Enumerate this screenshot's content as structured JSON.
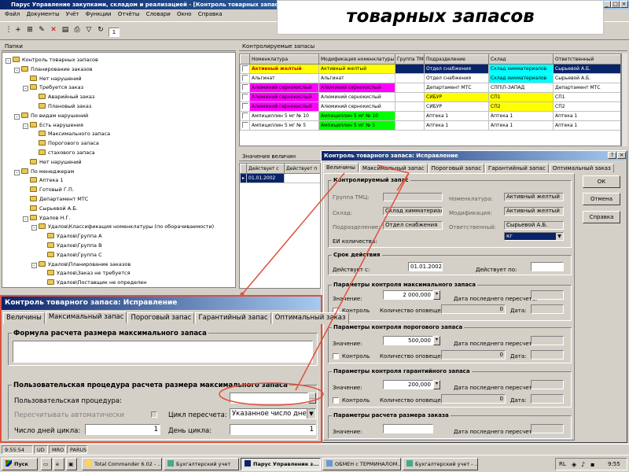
{
  "overlay_title": "товарных запасов",
  "window": {
    "title": "Парус Управление закупками, складом и реализацией - [Контроль товарных запасов]",
    "menu": [
      "Файл",
      "Документы",
      "Учёт",
      "Функции",
      "Отчёты",
      "Словари",
      "Окно",
      "Справка"
    ],
    "page_field": "1"
  },
  "left_panel": {
    "title": "Папки",
    "tree": [
      {
        "label": "Контроль товарных запасов",
        "level": 0,
        "exp": "-"
      },
      {
        "label": "Планирование заказов",
        "level": 1,
        "exp": "-"
      },
      {
        "label": "Нет нарушений",
        "level": 2,
        "exp": ""
      },
      {
        "label": "Требуется заказ",
        "level": 2,
        "exp": "-"
      },
      {
        "label": "Аварийный заказ",
        "level": 3,
        "exp": ""
      },
      {
        "label": "Плановый заказ",
        "level": 3,
        "exp": ""
      },
      {
        "label": "По видам нарушений",
        "level": 1,
        "exp": "-"
      },
      {
        "label": "Есть нарушения",
        "level": 2,
        "exp": "-"
      },
      {
        "label": "Максимального запаса",
        "level": 3,
        "exp": ""
      },
      {
        "label": "Порогового запаса",
        "level": 3,
        "exp": ""
      },
      {
        "label": "стахового запаса",
        "level": 3,
        "exp": ""
      },
      {
        "label": "Нет нарушений",
        "level": 2,
        "exp": ""
      },
      {
        "label": "По менеджерам",
        "level": 1,
        "exp": "-"
      },
      {
        "label": "Аптека 1",
        "level": 2,
        "exp": ""
      },
      {
        "label": "Готовый Г.П.",
        "level": 2,
        "exp": ""
      },
      {
        "label": "Департамент МТС",
        "level": 2,
        "exp": ""
      },
      {
        "label": "Сырьевой А.Б.",
        "level": 2,
        "exp": ""
      },
      {
        "label": "Удалов Н.Г.",
        "level": 2,
        "exp": "-"
      },
      {
        "label": "Удалов\\Классификация номенклатуры (по оборачиваемости)",
        "level": 3,
        "exp": "-"
      },
      {
        "label": "Удалов\\Группа А",
        "level": 4,
        "exp": ""
      },
      {
        "label": "Удалов\\Группа В",
        "level": 4,
        "exp": ""
      },
      {
        "label": "Удалов\\Группа С",
        "level": 4,
        "exp": ""
      },
      {
        "label": "Удалов\\Планирование заказов",
        "level": 3,
        "exp": "-"
      },
      {
        "label": "Удалов\\Заказ не требуется",
        "level": 4,
        "exp": ""
      },
      {
        "label": "Удалов\\Поставщик не определен",
        "level": 4,
        "exp": ""
      }
    ]
  },
  "right_panel": {
    "title": "Контролируемые запасы",
    "columns": [
      "",
      "Номенклатура",
      "Модификация номенклатуры",
      "Группа ТМЦ",
      "Подразделение",
      "Склад",
      "Ответственный"
    ],
    "rows": [
      {
        "cells": [
          "",
          "Активный желтый",
          "Активный желтый",
          "",
          "Отдел снабжения",
          "Склад химматериалов",
          "Сырьевой А.Б."
        ],
        "hl": "selected"
      },
      {
        "cells": [
          "",
          "Альгинат",
          "Альгинат",
          "",
          "Отдел снабжения",
          "Склад химматериалов",
          "Сырьевой А.Б."
        ],
        "hl": "cyan"
      },
      {
        "cells": [
          "",
          "Алюминий сернокислый",
          "Алюминий сернокислый",
          "",
          "Департамент МТС",
          "СПП\\П-ЗАПАД",
          "Департамент МТС"
        ],
        "hl": "magenta"
      },
      {
        "cells": [
          "",
          "Алюминий сернокислый",
          "Алюминий сернокислый",
          "",
          "СИБУР",
          "СП1",
          "СП1"
        ],
        "hl": "yellow"
      },
      {
        "cells": [
          "",
          "Алюминий сернокислый",
          "Алюминий сернокислый",
          "",
          "СИБУР",
          "СП2",
          "СП2"
        ],
        "hl": "yellow2"
      },
      {
        "cells": [
          "",
          "Ампициллин 5 мг № 10",
          "Ампициллин 5 мг № 10",
          "",
          "Аптека 1",
          "Аптека 1",
          "Аптека 1"
        ],
        "hl": "green"
      },
      {
        "cells": [
          "",
          "Ампициллин 5 мг № 5",
          "Ампициллин 5 мг № 5",
          "",
          "Аптека 1",
          "Аптека 1",
          "Аптека 1"
        ],
        "hl": "green"
      }
    ]
  },
  "values_panel": {
    "title": "Значения величин",
    "columns": [
      "Действует с",
      "Действует п"
    ],
    "rows": [
      [
        "01.01.2002",
        ""
      ]
    ]
  },
  "dialog_big": {
    "title": "Контроль товарного запаса: Исправление",
    "tabs": [
      "Величины",
      "Максимальный запас",
      "Пороговый запас",
      "Гарантийный запас",
      "Оптимальный заказ"
    ],
    "buttons": {
      "ok": "ОК",
      "cancel": "Отмена",
      "help": "Справка"
    },
    "controlled": {
      "title": "Контролируемый запас",
      "group_label": "Группа ТМЦ:",
      "group_value": "",
      "store_label": "Склад:",
      "store_value": "Склад химматериалов",
      "dept_label": "Подразделение:",
      "dept_value": "Отдел снабжения",
      "unit_label": "ЕИ количества:",
      "nom_label": "Номенклатура:",
      "nom_value": "Активный желтый",
      "mod_label": "Модификация:",
      "mod_value": "Активный желтый",
      "resp_label": "Ответственный:",
      "resp_value": "Сырьевой А.Б.",
      "unit_value": "кг"
    },
    "validity": {
      "title": "Срок действия",
      "from_label": "Действует с:",
      "from_value": "01.01.2002",
      "to_label": "Действует по:",
      "to_value": ""
    },
    "max": {
      "title": "Параметры контроля максимального запаса",
      "value_label": "Значение:",
      "value": "2 000,000",
      "date_label": "Дата последнего пересчета:",
      "control_label": "Контроль",
      "notif_label": "Количество оповещений:",
      "notif_value": "0",
      "date2_label": "Дата:"
    },
    "thr": {
      "title": "Параметры контроля порогового запаса",
      "value_label": "Значение:",
      "value": "500,000",
      "date_label": "Дата последнего пересчета:",
      "control_label": "Контроль",
      "notif_label": "Количество оповещений:",
      "notif_value": "0",
      "date2_label": "Дата:"
    },
    "guar": {
      "title": "Параметры контроля гарантийного запаса",
      "value_label": "Значение:",
      "value": "200,000",
      "date_label": "Дата последнего пересчета:",
      "control_label": "Контроль",
      "notif_label": "Количество оповещений:",
      "notif_value": "0",
      "date2_label": "Дата:"
    },
    "order": {
      "title": "Параметры расчета размера заказа",
      "value_label": "Значение:",
      "date_label": "Дата последнего пересчета:"
    }
  },
  "dialog_zoom": {
    "title": "Контроль товарного запаса: Исправление",
    "tabs": [
      "Величины",
      "Максимальный запас",
      "Пороговый запас",
      "Гарантийный запас",
      "Оптимальный заказ"
    ],
    "formula_title": "Формула расчета размера максимального запаса",
    "proc_title": "Пользовательская процедура расчета размера максимального запаса",
    "proc_label": "Пользовательская процедура:",
    "auto_label": "Пересчитывать автоматически",
    "cycle_label": "Цикл пересчета:",
    "cycle_value": "Указанное число дней",
    "days_label": "Число дней цикла:",
    "days_value": "1",
    "day_label": "День цикла:",
    "day_value": "1"
  },
  "statusbar": [
    "9:55:54",
    "UD",
    "MRO",
    "PARUS"
  ],
  "taskbar": {
    "start": "Пуск",
    "tasks": [
      "Total Commander 6.02 - ...",
      "Бухгалтерский учет",
      "Парус Управление з...",
      "ОБМЕН с ТЕРМИНАЛОМ....",
      "Бухгалтерский учет - ..."
    ],
    "lang": "RL",
    "clock": "9:55"
  },
  "colors": {
    "selected": "#0a246a",
    "cyan": "#00ffff",
    "magenta": "#ff00ff",
    "yellow": "#ffff00",
    "green": "#00ff00",
    "annot": "#e0503c"
  }
}
